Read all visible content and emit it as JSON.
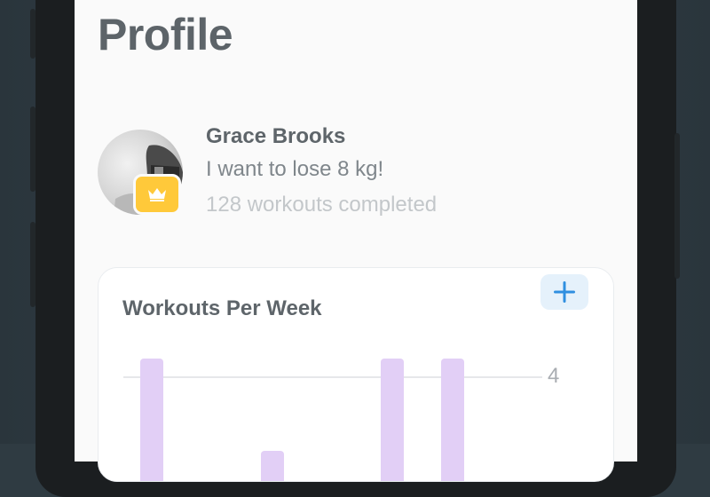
{
  "screen": {
    "title": "Profile"
  },
  "profile": {
    "name": "Grace Brooks",
    "goal": "I want to lose 8 kg!",
    "workouts_completed": "128 workouts completed",
    "badge_icon": "crown-icon"
  },
  "workouts_card": {
    "title": "Workouts Per Week",
    "add_icon": "plus-icon",
    "chart_data": {
      "type": "bar",
      "ytick_label": "4",
      "values": [
        4,
        1,
        4,
        4
      ],
      "bar_color": "#e2cff6"
    }
  },
  "colors": {
    "background": "#fafafa",
    "badge": "#ffc93a",
    "accent": "#2f8fe0",
    "bar": "#e2cff6"
  }
}
